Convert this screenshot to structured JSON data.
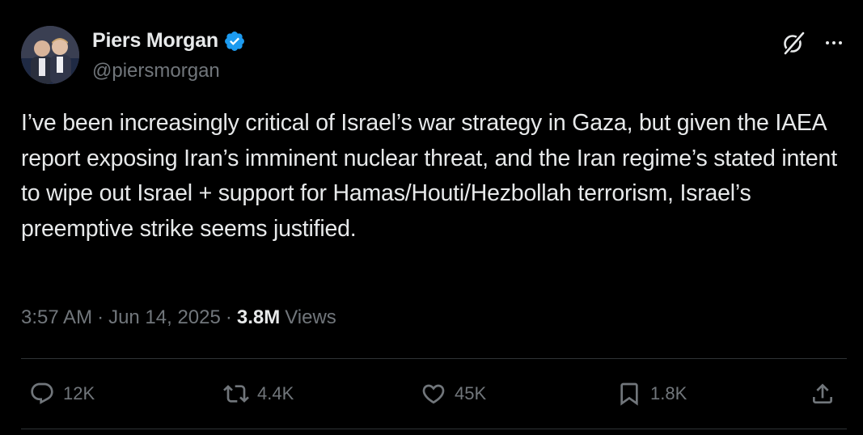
{
  "author": {
    "display_name": "Piers Morgan",
    "handle": "@piersmorgan",
    "verified": true,
    "verified_color": "#1d9bf0"
  },
  "tweet": {
    "text": "I’ve been increasingly critical of Israel’s war strategy in Gaza, but given the IAEA report exposing Iran’s imminent nuclear threat, and the Iran regime’s stated intent to wipe out Israel + support for Hamas/Houti/Hezbollah terrorism, Israel’s preemptive strike seems justified."
  },
  "meta": {
    "time": "3:57 AM",
    "separator": "·",
    "date": "Jun 14, 2025",
    "views_count": "3.8M",
    "views_label": "Views"
  },
  "header_icons": {
    "grok": "grok-icon",
    "more": "more-icon"
  },
  "actions": {
    "replies": "12K",
    "retweets": "4.4K",
    "likes": "45K",
    "bookmarks": "1.8K"
  },
  "colors": {
    "background": "#000000",
    "text_primary": "#e7e9ea",
    "text_secondary": "#71767b",
    "divider": "#2f3336"
  }
}
